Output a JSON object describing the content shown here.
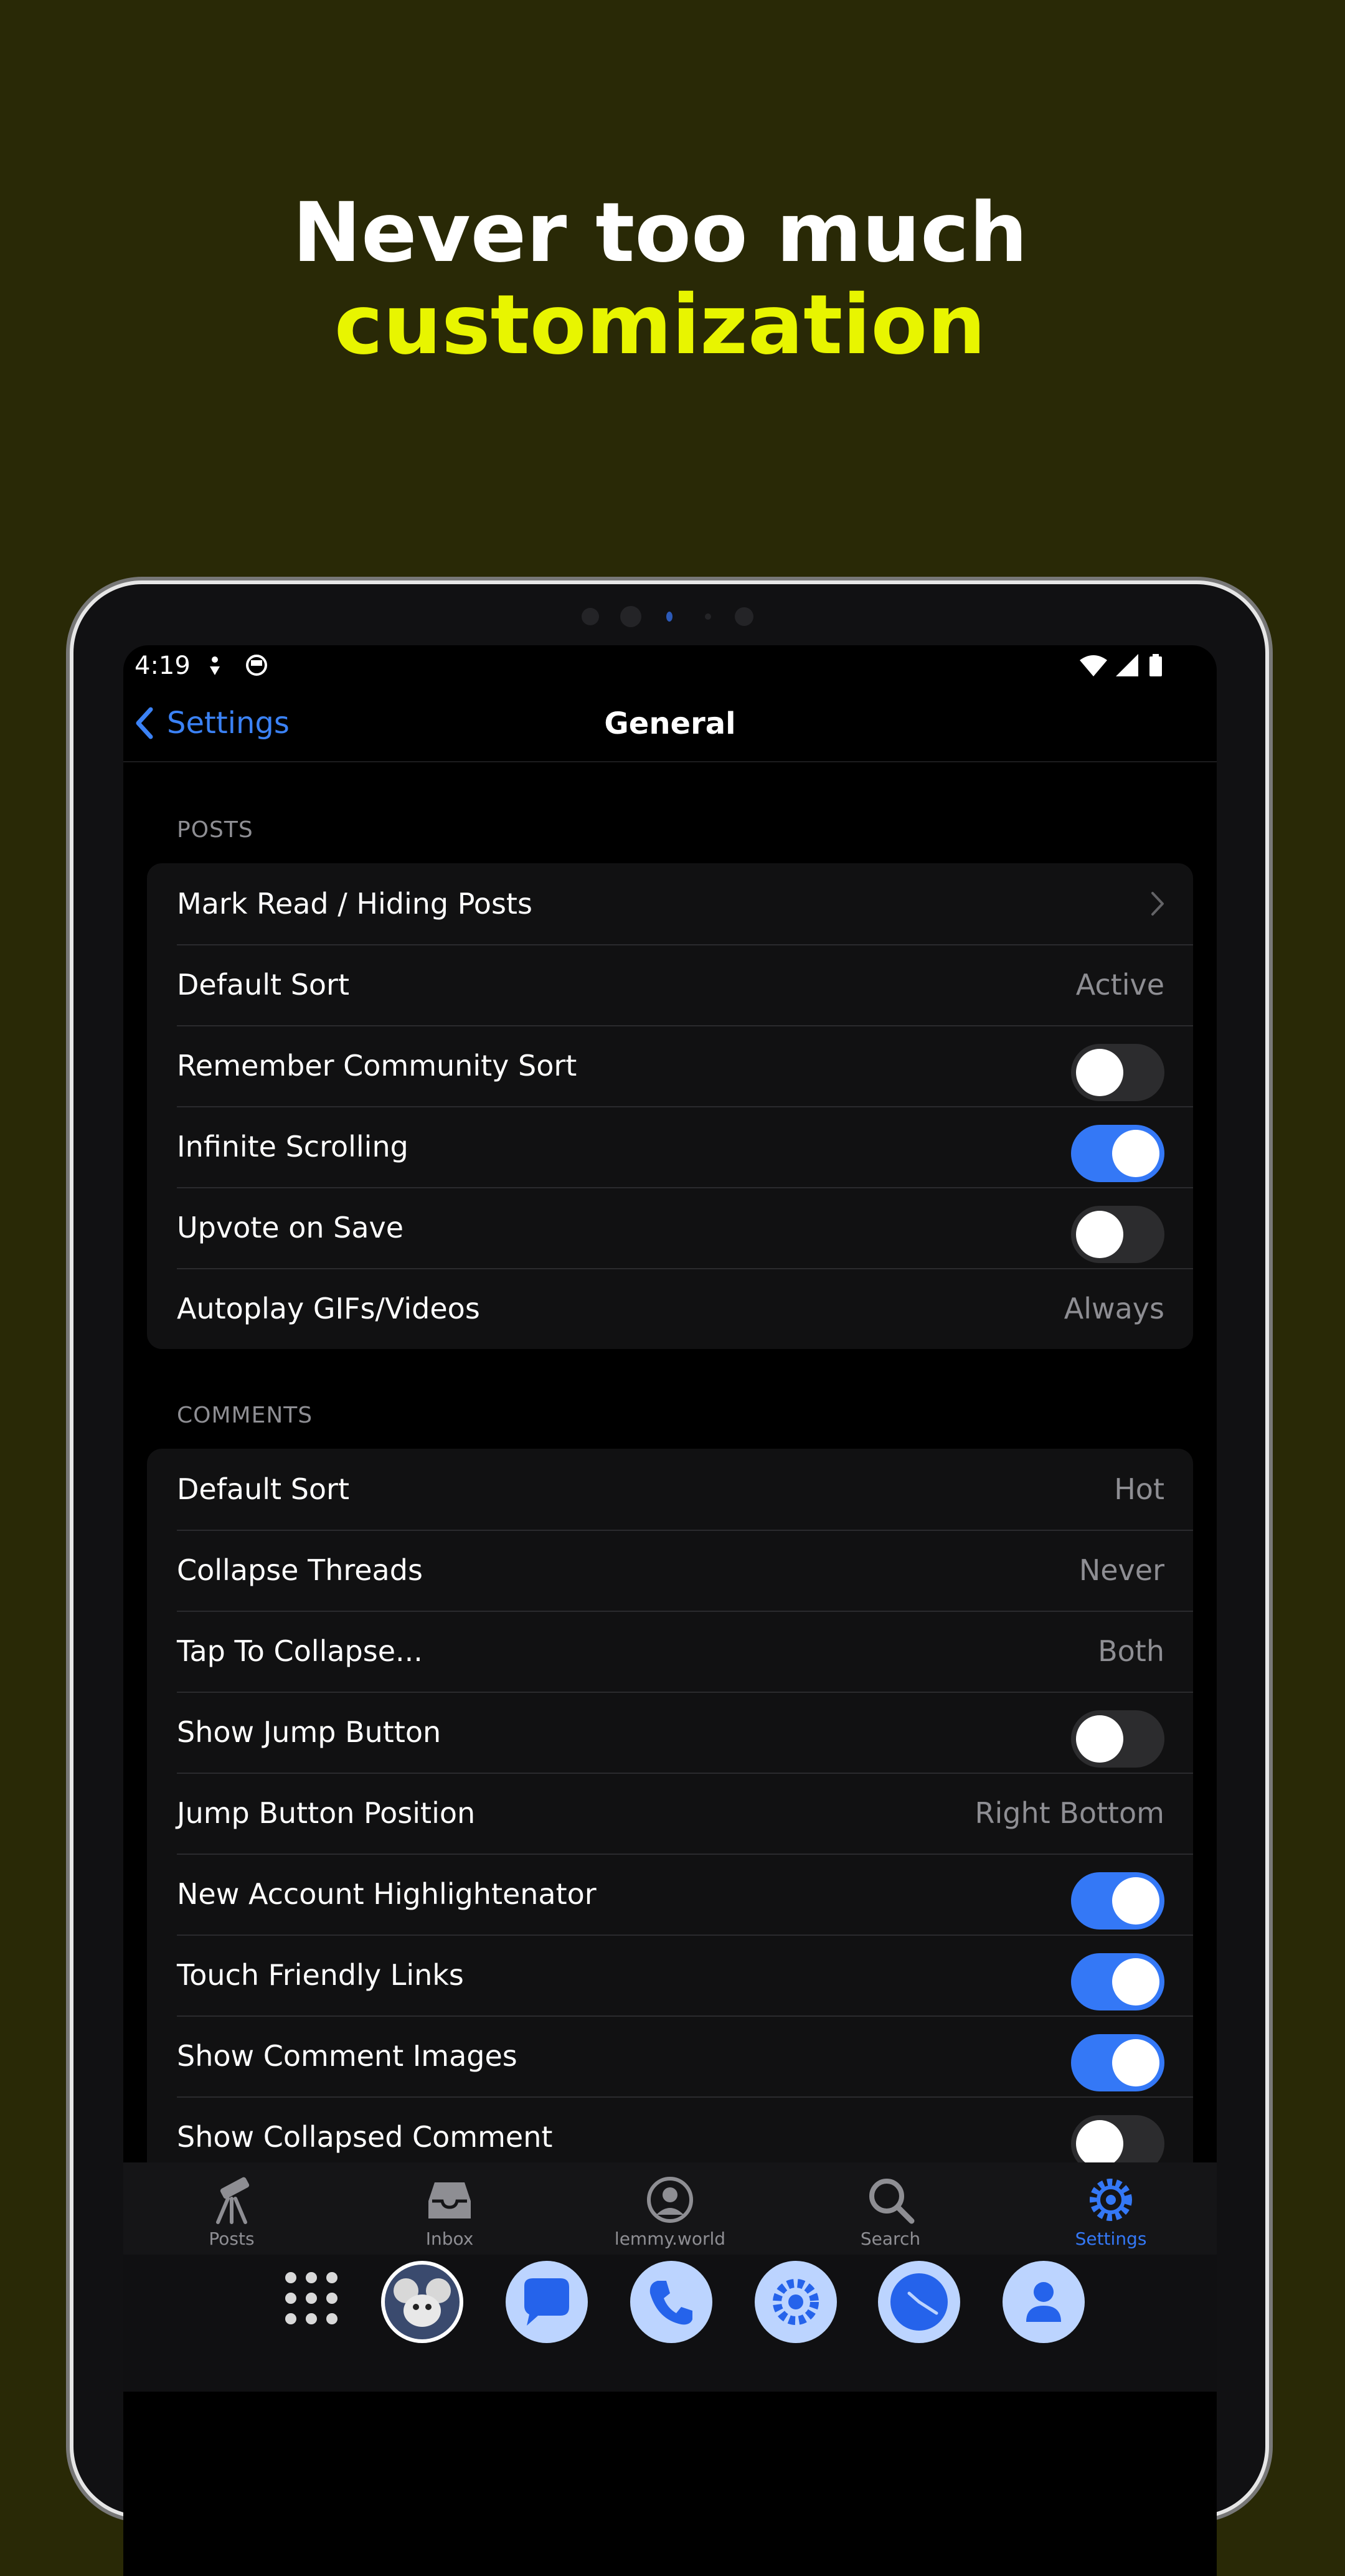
{
  "promo": {
    "line1": "Never too much",
    "line2": "customization"
  },
  "status_bar": {
    "time": "4:19"
  },
  "nav": {
    "back_label": "Settings",
    "title": "General"
  },
  "sections": {
    "posts": {
      "label": "POSTS",
      "rows": {
        "mark_read": {
          "label": "Mark Read / Hiding Posts"
        },
        "default_sort": {
          "label": "Default Sort",
          "value": "Active"
        },
        "remember_sort": {
          "label": "Remember Community Sort",
          "toggle": false
        },
        "infinite_scroll": {
          "label": "Infinite Scrolling",
          "toggle": true
        },
        "upvote_save": {
          "label": "Upvote on Save",
          "toggle": false
        },
        "autoplay": {
          "label": "Autoplay GIFs/Videos",
          "value": "Always"
        }
      }
    },
    "comments": {
      "label": "COMMENTS",
      "rows": {
        "default_sort": {
          "label": "Default Sort",
          "value": "Hot"
        },
        "collapse_threads": {
          "label": "Collapse Threads",
          "value": "Never"
        },
        "tap_collapse": {
          "label": "Tap To Collapse...",
          "value": "Both"
        },
        "show_jump": {
          "label": "Show Jump Button",
          "toggle": false
        },
        "jump_position": {
          "label": "Jump Button Position",
          "value": "Right Bottom"
        },
        "highlightenator": {
          "label": "New Account Highlightenator",
          "toggle": true
        },
        "touch_links": {
          "label": "Touch Friendly Links",
          "toggle": true
        },
        "comment_images": {
          "label": "Show Comment Images",
          "toggle": true
        },
        "collapsed_comment": {
          "label": "Show Collapsed Comment",
          "toggle": false
        }
      }
    }
  },
  "tabbar": {
    "posts": "Posts",
    "inbox": "Inbox",
    "account": "lemmy.world",
    "search": "Search",
    "settings": "Settings",
    "active": "settings"
  },
  "colors": {
    "accent": "#3478f6",
    "headline_highlight": "#e8f500",
    "backdrop": "#292906"
  },
  "icons": {
    "tabs": [
      "telescope-icon",
      "inbox-tray-icon",
      "user-circle-icon",
      "search-icon",
      "gear-icon"
    ],
    "dock": [
      "app-grid-icon",
      "mouse-avatar-app-icon",
      "messages-icon",
      "phone-icon",
      "settings-app-icon",
      "clock-icon",
      "contacts-icon"
    ]
  }
}
